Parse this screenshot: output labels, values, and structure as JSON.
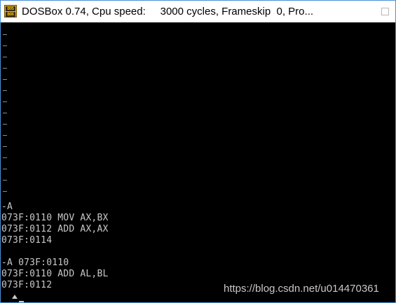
{
  "window": {
    "title": "DOSBox 0.74, Cpu speed:     3000 cycles, Frameskip  0, Pro...",
    "icon": "dosbox-icon",
    "icon_text_top": "DOS",
    "icon_text_bottom": "BOX"
  },
  "console": {
    "lines": [
      "-A",
      "073F:0110 MOV AX,BX",
      "073F:0112 ADD AX,AX",
      "073F:0114",
      "",
      "-A 073F:0110",
      "073F:0110 ADD AL,BL",
      "073F:0112"
    ]
  },
  "watermark": "https://blog.csdn.net/u014470361"
}
